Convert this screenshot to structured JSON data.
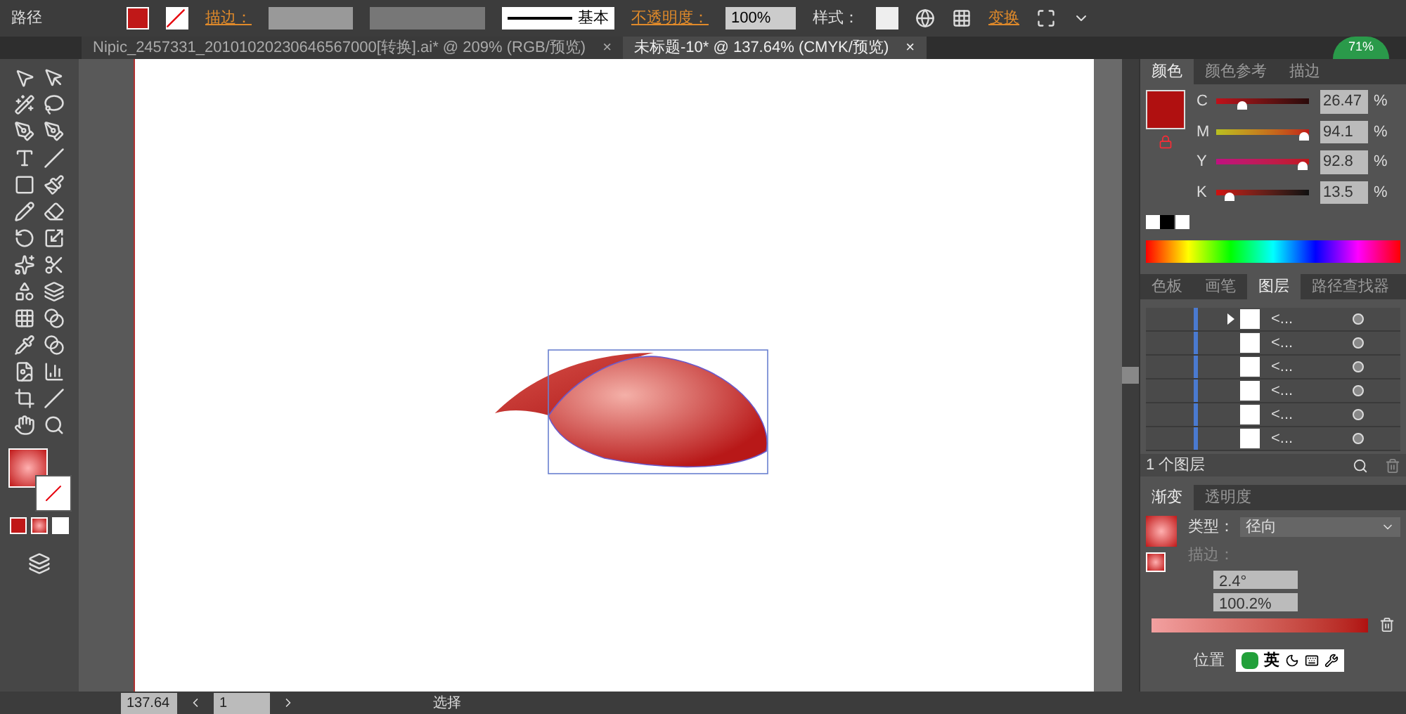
{
  "control_bar": {
    "object_type": "路径",
    "stroke_label": "描边：",
    "stroke_style": "基本",
    "opacity_label": "不透明度：",
    "opacity_value": "100%",
    "style_label": "样式：",
    "transform_link": "变换"
  },
  "document_tabs": [
    {
      "title": "Nipic_2457331_20101020230646567000[转换].ai* @ 209% (RGB/预览)",
      "close": "×",
      "selected": false
    },
    {
      "title": "未标题-10* @ 137.64% (CMYK/预览)",
      "close": "×",
      "selected": true
    }
  ],
  "system_monitor": {
    "reading": "71%"
  },
  "color_panel": {
    "tabs": [
      {
        "label": "颜色",
        "selected": true
      },
      {
        "label": "颜色参考",
        "selected": false
      },
      {
        "label": "描边",
        "selected": false
      }
    ],
    "channels": [
      {
        "name": "C",
        "value": "26.47",
        "unit": "%",
        "level": 0.27
      },
      {
        "name": "M",
        "value": "94.1",
        "unit": "%",
        "level": 0.94
      },
      {
        "name": "Y",
        "value": "92.8",
        "unit": "%",
        "level": 0.93
      },
      {
        "name": "K",
        "value": "13.5",
        "unit": "%",
        "level": 0.14
      }
    ]
  },
  "layers_panel": {
    "tabs": [
      {
        "label": "色板",
        "selected": false
      },
      {
        "label": "画笔",
        "selected": false
      },
      {
        "label": "图层",
        "selected": true
      },
      {
        "label": "路径查找器",
        "selected": false
      }
    ],
    "rows": [
      {
        "name": "<...",
        "expandable": true
      },
      {
        "name": "<...",
        "expandable": false
      },
      {
        "name": "<...",
        "expandable": false
      },
      {
        "name": "<...",
        "expandable": false
      },
      {
        "name": "<...",
        "expandable": false
      },
      {
        "name": "<...",
        "expandable": false
      }
    ],
    "footer": "1 个图层"
  },
  "gradient_panel": {
    "tabs": [
      {
        "label": "渐变",
        "selected": true
      },
      {
        "label": "透明度",
        "selected": false
      }
    ],
    "type_label": "类型：",
    "type_value": "径向",
    "stroke_label": "描边：",
    "angle": "2.4°",
    "aspect": "100.2%",
    "location_label": "位置"
  },
  "ime": {
    "language": "英"
  },
  "status_bar": {
    "zoom": "137.64",
    "artboard": "1",
    "tool": "选择"
  }
}
